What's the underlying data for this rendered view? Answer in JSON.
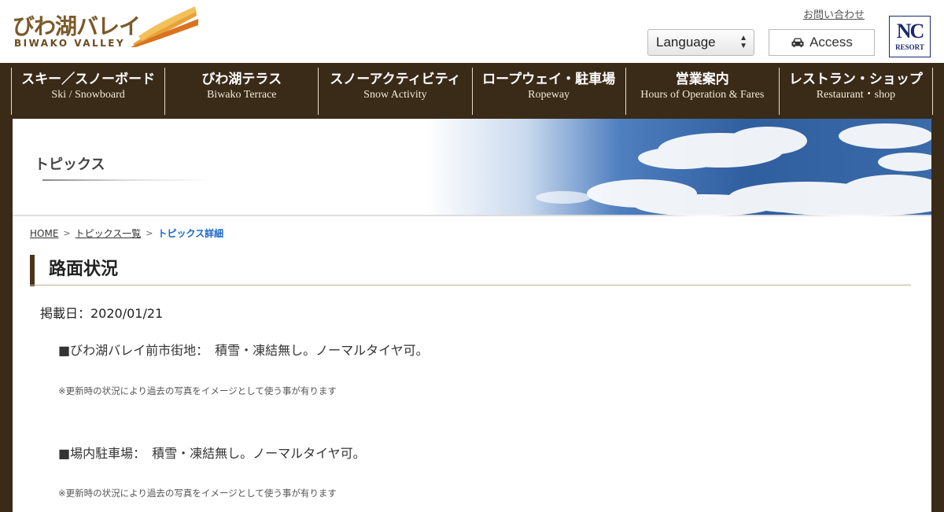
{
  "header": {
    "logo_jp": "びわ湖バレイ",
    "logo_en": "BIWAKO VALLEY",
    "contact_link": "お問い合わせ",
    "language_label": "Language",
    "access_label": "Access",
    "nc_logo_top": "NC",
    "nc_logo_bottom": "RESORT"
  },
  "nav": {
    "items": [
      {
        "jp": "スキー／スノーボード",
        "en": "Ski / Snowboard"
      },
      {
        "jp": "びわ湖テラス",
        "en": "Biwako Terrace"
      },
      {
        "jp": "スノーアクティビティ",
        "en": "Snow Activity"
      },
      {
        "jp": "ロープウェイ・駐車場",
        "en": "Ropeway"
      },
      {
        "jp": "営業案内",
        "en": "Hours of Operation & Fares"
      },
      {
        "jp": "レストラン・ショップ",
        "en": "Restaurant・shop"
      }
    ]
  },
  "banner": {
    "title": "トピックス"
  },
  "breadcrumb": {
    "home": "HOME",
    "topics_list": "トピックス一覧",
    "current": "トピックス詳細"
  },
  "post": {
    "title": "路面状況",
    "date": "掲載日：2020/01/21",
    "line1": "■びわ湖バレイ前市街地：　積雪・凍結無し。ノーマルタイヤ可。",
    "note1": "※更新時の状況により過去の写真をイメージとして使う事が有ります",
    "line2": "■場内駐車場：　積雪・凍結無し。ノーマルタイヤ可。",
    "note2": "※更新時の状況により過去の写真をイメージとして使う事が有ります"
  },
  "colors": {
    "nav_bg": "#3a2a18",
    "breadcrumb_current": "#1a66c8",
    "title_accent": "#4a3418"
  }
}
